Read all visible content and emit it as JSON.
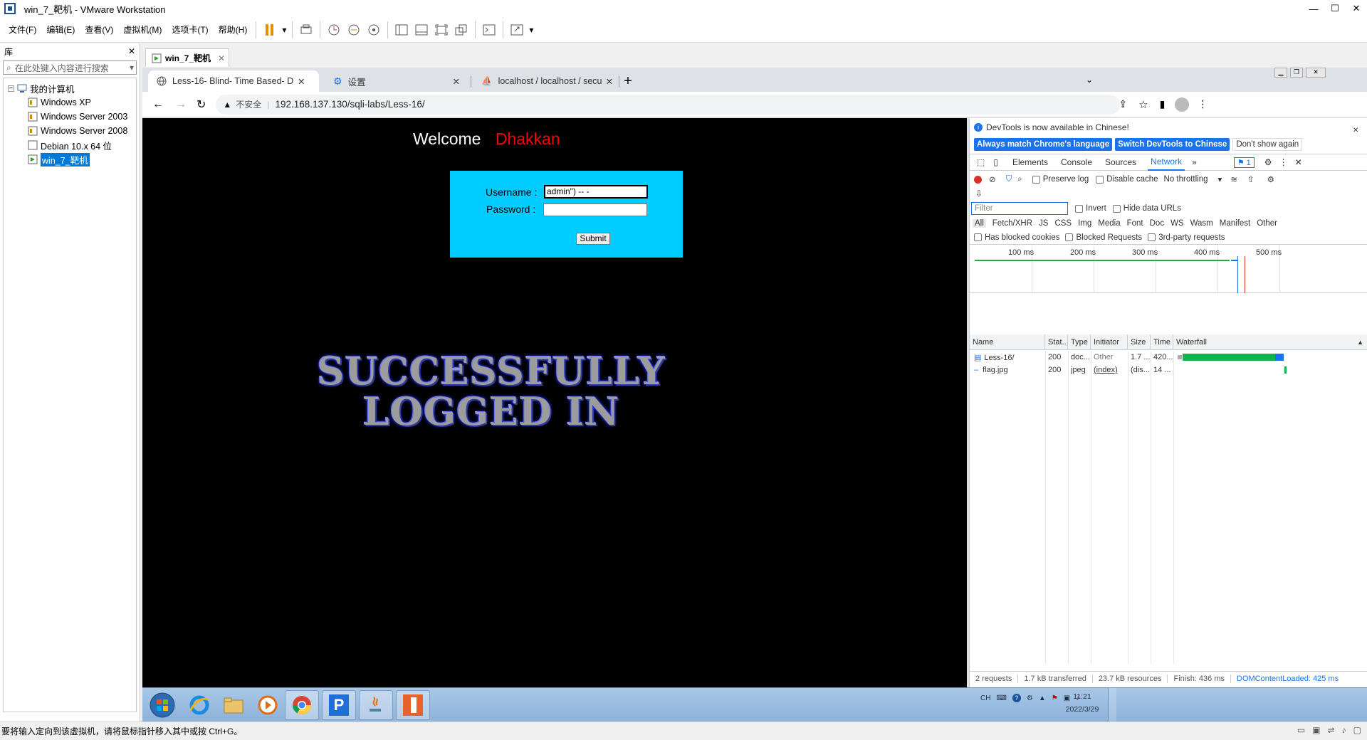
{
  "vmware": {
    "title": "win_7_靶机 - VMware Workstation",
    "menu": [
      "文件(F)",
      "编辑(E)",
      "查看(V)",
      "虚拟机(M)",
      "选项卡(T)",
      "帮助(H)"
    ],
    "library": {
      "title": "库",
      "search_placeholder": "在此处键入内容进行搜索",
      "root": "我的计算机",
      "vms": [
        "Windows XP",
        "Windows Server 2003",
        "Windows Server 2008",
        "Debian 10.x 64 位",
        "win_7_靶机"
      ]
    },
    "tab": "win_7_靶机",
    "status": "要将输入定向到该虚拟机，请将鼠标指针移入其中或按 Ctrl+G。"
  },
  "browser": {
    "tabs": [
      "Less-16- Blind- Time Based- D",
      "设置",
      "localhost / localhost / security"
    ],
    "security_label": "不安全",
    "url": "192.168.137.130/sqli-labs/Less-16/"
  },
  "page": {
    "welcome": "Welcome",
    "name": "Dhakkan",
    "username_label": "Username :",
    "password_label": "Password :",
    "username_value": "admin\") -- -",
    "password_value": "",
    "submit": "Submit",
    "banner_line1": "SUCCESSFULLY",
    "banner_line2": "LOGGED IN"
  },
  "devtools": {
    "notice": "DevTools is now available in Chinese!",
    "btn_match": "Always match Chrome's language",
    "btn_switch": "Switch DevTools to Chinese",
    "btn_dont": "Don't show again",
    "tabs": [
      "Elements",
      "Console",
      "Sources",
      "Network"
    ],
    "active_tab": "Network",
    "issues": "1",
    "preserve_log": "Preserve log",
    "disable_cache": "Disable cache",
    "throttling": "No throttling",
    "filter_placeholder": "Filter",
    "invert": "Invert",
    "hide_data_urls": "Hide data URLs",
    "types": [
      "All",
      "Fetch/XHR",
      "JS",
      "CSS",
      "Img",
      "Media",
      "Font",
      "Doc",
      "WS",
      "Wasm",
      "Manifest",
      "Other"
    ],
    "has_blocked": "Has blocked cookies",
    "blocked_requests": "Blocked Requests",
    "third_party": "3rd-party requests",
    "timeline_ticks": [
      "100 ms",
      "200 ms",
      "300 ms",
      "400 ms",
      "500 ms"
    ],
    "columns": [
      "Name",
      "Stat..",
      "Type",
      "Initiator",
      "Size",
      "Time",
      "Waterfall"
    ],
    "rows": [
      {
        "name": "Less-16/",
        "status": "200",
        "type": "doc...",
        "initiator": "Other",
        "size": "1.7 ...",
        "time": "420..."
      },
      {
        "name": "flag.jpg",
        "status": "200",
        "type": "jpeg",
        "initiator": "(index)",
        "size": "(dis...",
        "time": "14 ..."
      }
    ],
    "summary": {
      "requests": "2 requests",
      "transferred": "1.7 kB transferred",
      "resources": "23.7 kB resources",
      "finish": "Finish: 436 ms",
      "dcl": "DOMContentLoaded: 425 ms"
    }
  },
  "tray": {
    "lang": "CH",
    "time": "11:21",
    "date": "2022/3/29"
  }
}
